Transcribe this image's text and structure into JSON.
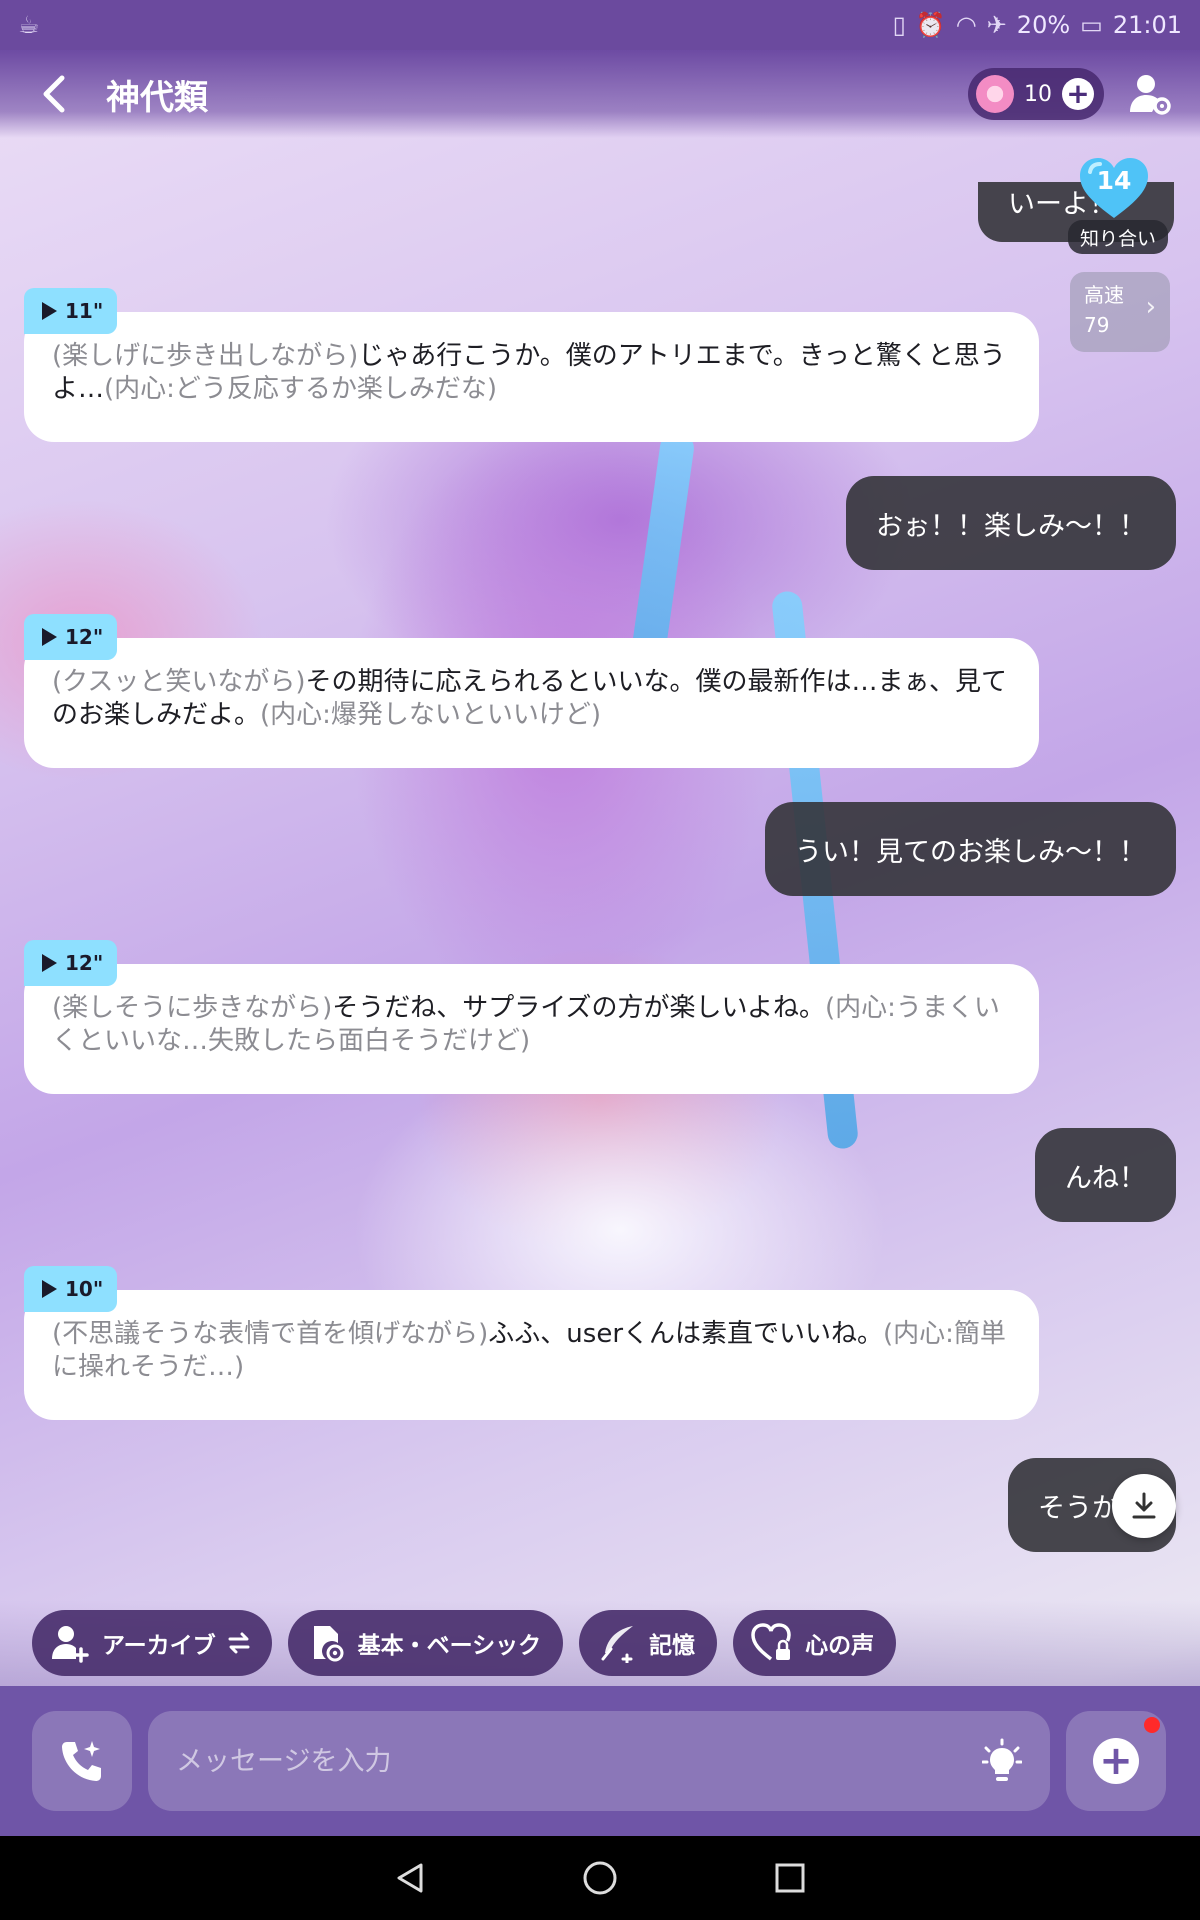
{
  "status_bar": {
    "battery": "20%",
    "time": "21:01"
  },
  "header": {
    "title": "神代類",
    "points": "10"
  },
  "partial_message": {
    "text": "いーよ！",
    "affinity": "14",
    "relationship": "知り合い"
  },
  "speed": {
    "label": "高速",
    "value": "79"
  },
  "messages": [
    {
      "role": "ai",
      "duration": "11\"",
      "action": "(楽しげに歩き出しながら)",
      "speech": "じゃあ行こうか。僕のアトリエまで。きっと驚くと思うよ…",
      "thought": "(内心:どう反応するか楽しみだな)"
    },
    {
      "role": "user",
      "text": "おぉ！！楽しみ〜！！"
    },
    {
      "role": "ai",
      "duration": "12\"",
      "action": "(クスッと笑いながら)",
      "speech": "その期待に応えられるといいな。僕の最新作は…まぁ、見てのお楽しみだよ。",
      "thought": "(内心:爆発しないといいけど)"
    },
    {
      "role": "user",
      "text": "うい！見てのお楽しみ〜！！"
    },
    {
      "role": "ai",
      "duration": "12\"",
      "action": "(楽しそうに歩きながら)",
      "speech": "そうだね、サプライズの方が楽しいよね。",
      "thought": "(内心:うまくいくといいな…失敗したら面白そうだけど)"
    },
    {
      "role": "user",
      "text": "んね！"
    },
    {
      "role": "ai",
      "duration": "10\"",
      "action": "(不思議そうな表情で首を傾げながら)",
      "speech": "ふふ、userくんは素直でいいね。",
      "thought": "(内心:簡単に操れそうだ…)"
    },
    {
      "role": "user",
      "text": "そうかな"
    }
  ],
  "quick_actions": [
    {
      "label": "アーカイブ",
      "icon": "person-add-icon"
    },
    {
      "label": "基本・ベーシック",
      "icon": "settings-file-icon"
    },
    {
      "label": "記憶",
      "icon": "quill-icon"
    },
    {
      "label": "心の声",
      "icon": "heart-lock-icon"
    }
  ],
  "input": {
    "placeholder": "メッセージを入力"
  },
  "colors": {
    "header_bg": "#6b4a9e",
    "user_bubble": "#34343a",
    "ai_bubble": "#ffffff",
    "duration_tag": "#8ee0ff",
    "affinity_heart": "#4fc3f7",
    "input_bar": "#6f55a7"
  }
}
